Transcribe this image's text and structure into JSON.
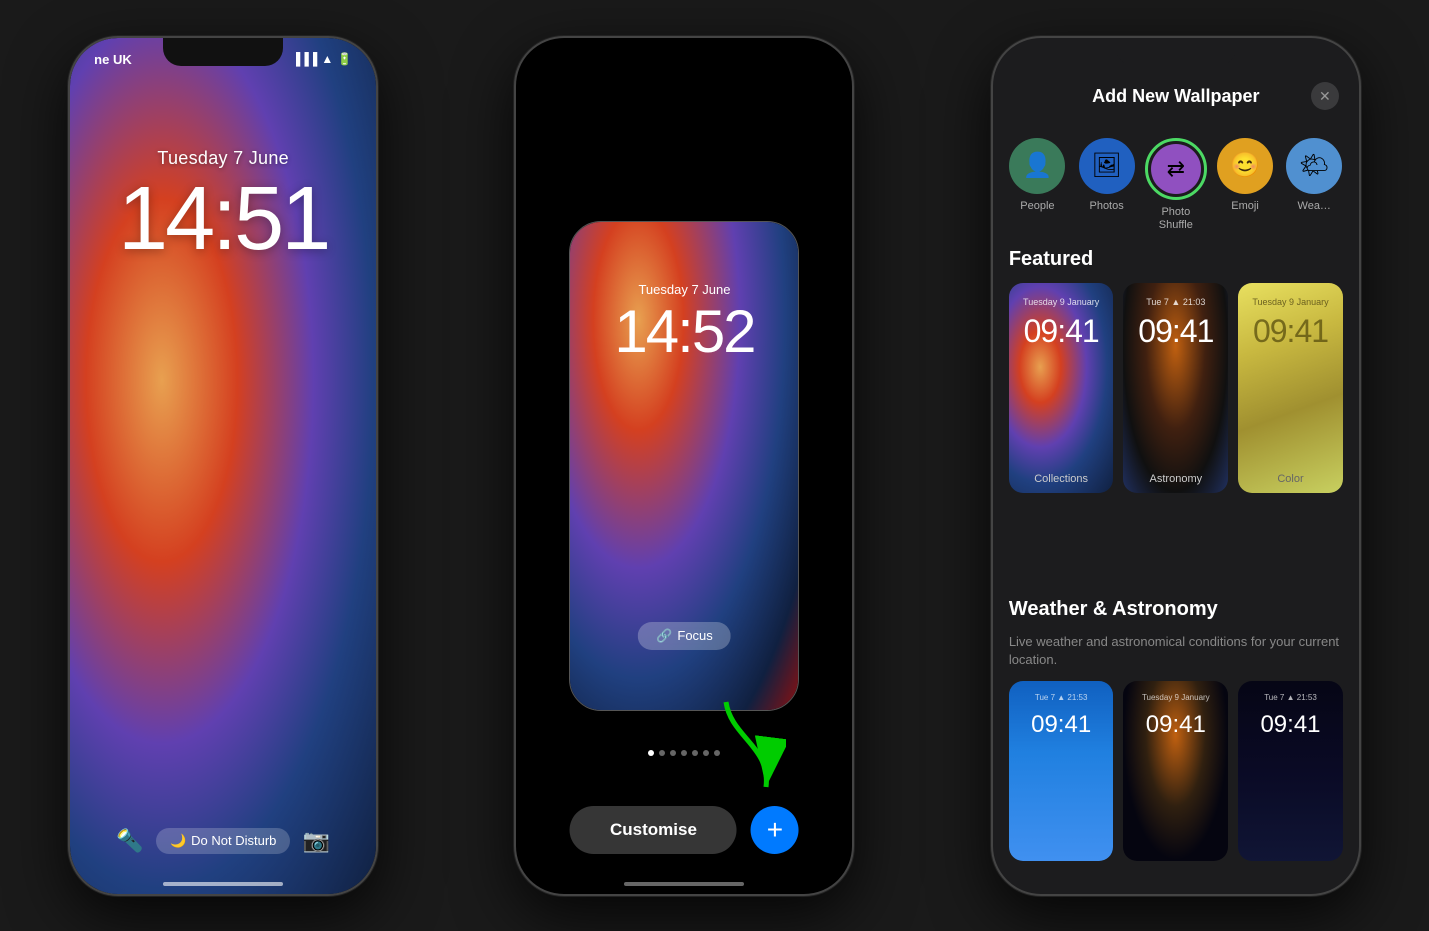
{
  "phone1": {
    "carrier": "ne UK",
    "date": "Tuesday 7 June",
    "time": "14:51",
    "dnd_label": "Do Not Disturb",
    "home_indicator": true
  },
  "phone2": {
    "date": "Tuesday 7 June",
    "time": "14:52",
    "focus_label": "Focus",
    "customise_label": "Customise",
    "plus_label": "+",
    "dots_count": 7,
    "active_dot": 0
  },
  "phone3": {
    "panel_title": "Add New Wallpaper",
    "close_label": "✕",
    "wp_types": [
      {
        "label": "People",
        "color": "#3a7a5a",
        "icon": "👤"
      },
      {
        "label": "Photos",
        "color": "#2060c0",
        "icon": "🖼"
      },
      {
        "label": "Photo Shuffle",
        "color": "#9050c0",
        "icon": "⇄",
        "highlighted": true
      },
      {
        "label": "Emoji",
        "color": "#e0a020",
        "icon": "😊"
      },
      {
        "label": "Wea…",
        "color": "#5090d0",
        "icon": "☁"
      }
    ],
    "featured_title": "Featured",
    "featured_cards": [
      {
        "label": "Collections",
        "date": "Tuesday 9 January",
        "time": "09:41",
        "style": "colorful"
      },
      {
        "label": "Astronomy",
        "date": "Tue 7 • 21:03",
        "time": "09:41",
        "style": "dark"
      },
      {
        "label": "Color",
        "date": "Tuesday 9 January",
        "time": "09:41",
        "style": "yellow"
      }
    ],
    "weather_title": "Weather & Astronomy",
    "weather_desc": "Live weather and astronomical conditions for your current location.",
    "weather_cards": [
      {
        "date": "Tue 7 • 21:53",
        "time": "09:41",
        "style": "blue"
      },
      {
        "date": "Tuesday 9 January",
        "time": "09:41",
        "style": "dark"
      },
      {
        "date": "Tue 7 • 21:53",
        "time": "09:41",
        "style": "night"
      }
    ]
  }
}
